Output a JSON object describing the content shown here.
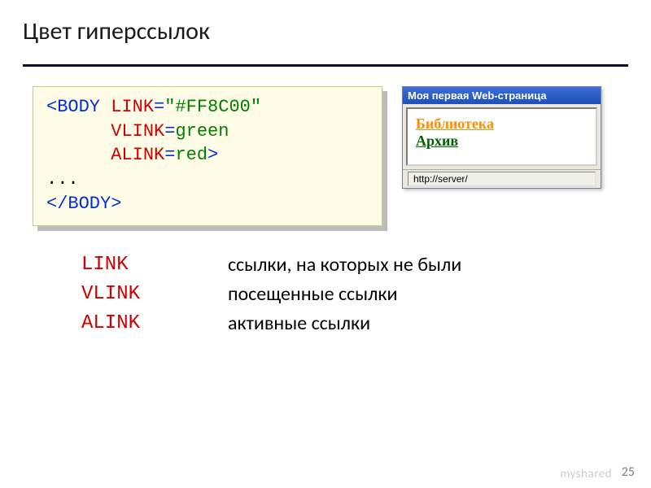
{
  "title": "Цвет гиперссылок",
  "code": {
    "l1_open": "<BODY ",
    "l1_attr": "LINK",
    "l1_eq": "=",
    "l1_val": "\"#FF8C00\"",
    "l2_attr": "VLINK",
    "l2_eq": "=",
    "l2_val": "green",
    "l3_attr": "ALINK",
    "l3_eq": "=",
    "l3_val": "red",
    "l3_close": ">",
    "l4": "...",
    "l5": "</BODY>"
  },
  "browser": {
    "title": "Моя первая Web-страница",
    "link1": "Библиотека",
    "link2": "Архив",
    "status": "http://server/"
  },
  "legend": {
    "link_key": "LINK",
    "link_desc": "ссылки, на которых не были",
    "vlink_key": "VLINK",
    "vlink_desc": "посещенные ссылки",
    "alink_key": "ALINK",
    "alink_desc": "активные ссылки"
  },
  "page_no": "25",
  "watermark": "myshared"
}
